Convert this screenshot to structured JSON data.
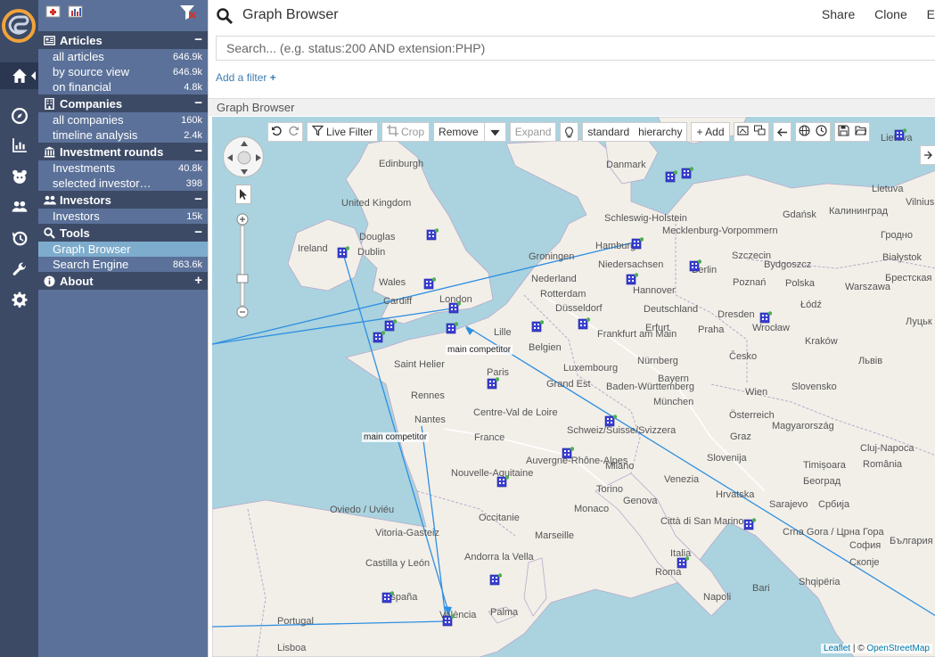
{
  "sidebar": {
    "sections": [
      {
        "title": "Articles",
        "toggle": "−",
        "items": [
          {
            "label": "all articles",
            "count": "646.9k"
          },
          {
            "label": "by source view",
            "count": "646.9k"
          },
          {
            "label": "on financial",
            "count": "4.8k"
          }
        ]
      },
      {
        "title": "Companies",
        "toggle": "−",
        "items": [
          {
            "label": "all companies",
            "count": "160k"
          },
          {
            "label": "timeline analysis",
            "count": "2.4k"
          }
        ]
      },
      {
        "title": "Investment rounds",
        "toggle": "−",
        "items": [
          {
            "label": "Investments",
            "count": "40.8k"
          },
          {
            "label": "selected investor…",
            "count": "398"
          }
        ]
      },
      {
        "title": "Investors",
        "toggle": "−",
        "items": [
          {
            "label": "Investors",
            "count": "15k"
          }
        ]
      },
      {
        "title": "Tools",
        "toggle": "−",
        "items": [
          {
            "label": "Graph Browser",
            "count": ""
          },
          {
            "label": "Search Engine",
            "count": "863.6k"
          }
        ]
      },
      {
        "title": "About",
        "toggle": "+",
        "items": []
      }
    ]
  },
  "header": {
    "title": "Graph Browser",
    "share": "Share",
    "clone": "Clone",
    "extra": "E"
  },
  "search": {
    "placeholder": "Search... (e.g. status:200 AND extension:PHP)"
  },
  "add_filter": "Add a filter",
  "panel_title": "Graph Browser",
  "toolbar": {
    "live_filter": "Live Filter",
    "crop": "Crop",
    "remove": "Remove",
    "expand": "Expand",
    "layout_standard": "standard",
    "layout_hierarchy": "hierarchy",
    "add": "+ Add"
  },
  "map": {
    "places": [
      {
        "text": "Edinburgh"
      },
      {
        "text": "Danmark"
      },
      {
        "text": "United Kingdom"
      },
      {
        "text": "Ireland"
      },
      {
        "text": "Douglas"
      },
      {
        "text": "Dublin"
      },
      {
        "text": "Wales"
      },
      {
        "text": "Cardiff"
      },
      {
        "text": "London"
      },
      {
        "text": "Hamburg"
      },
      {
        "text": "Groningen"
      },
      {
        "text": "Nederland"
      },
      {
        "text": "Rotterdam"
      },
      {
        "text": "Hannover"
      },
      {
        "text": "Berlin"
      },
      {
        "text": "Szczecin"
      },
      {
        "text": "Gdańsk"
      },
      {
        "text": "Калининград"
      },
      {
        "text": "Lietuva"
      },
      {
        "text": "Vilnius"
      },
      {
        "text": "Гродно"
      },
      {
        "text": "Białystok"
      },
      {
        "text": "Bydgoszcz"
      },
      {
        "text": "Poznań"
      },
      {
        "text": "Polska"
      },
      {
        "text": "Warszawa"
      },
      {
        "text": "Łódź"
      },
      {
        "text": "Deutschland"
      },
      {
        "text": "Düsseldorf"
      },
      {
        "text": "Dresden"
      },
      {
        "text": "Wrocław"
      },
      {
        "text": "Lille"
      },
      {
        "text": "Belgien"
      },
      {
        "text": "Frankfurt am Main"
      },
      {
        "text": "Erfurt"
      },
      {
        "text": "Praha"
      },
      {
        "text": "Česko"
      },
      {
        "text": "Kraków"
      },
      {
        "text": "Luxembourg"
      },
      {
        "text": "Nürnberg"
      },
      {
        "text": "Saint Helier"
      },
      {
        "text": "Paris"
      },
      {
        "text": "Rennes"
      },
      {
        "text": "Nantes"
      },
      {
        "text": "Centre-Val de Loire"
      },
      {
        "text": "France"
      },
      {
        "text": "München"
      },
      {
        "text": "Wien"
      },
      {
        "text": "Österreich"
      },
      {
        "text": "Slovensko"
      },
      {
        "text": "Magyarország"
      },
      {
        "text": "Schweiz/Suisse/Svizzera"
      },
      {
        "text": "Graz"
      },
      {
        "text": "Cluj-Napoca"
      },
      {
        "text": "România"
      },
      {
        "text": "Nouvelle-Aquitaine"
      },
      {
        "text": "Auvergne-Rhône-Alpes"
      },
      {
        "text": "Milano"
      },
      {
        "text": "Venezia"
      },
      {
        "text": "Slovenija"
      },
      {
        "text": "Hrvatska"
      },
      {
        "text": "Timișoara"
      },
      {
        "text": "Београд"
      },
      {
        "text": "Torino"
      },
      {
        "text": "Genova"
      },
      {
        "text": "Sarajevo"
      },
      {
        "text": "Србија"
      },
      {
        "text": "Occitanie"
      },
      {
        "text": "Monaco"
      },
      {
        "text": "Marseille"
      },
      {
        "text": "Città di San Marino"
      },
      {
        "text": "Italia"
      },
      {
        "text": "Crna Gora / Црна Гора"
      },
      {
        "text": "София"
      },
      {
        "text": "Скопје"
      },
      {
        "text": "Shqipëria"
      },
      {
        "text": "Oviedo / Uviéu"
      },
      {
        "text": "Vitoria-Gasteiz"
      },
      {
        "text": "Castilla y León"
      },
      {
        "text": "Andorra la Vella"
      },
      {
        "text": "Roma"
      },
      {
        "text": "Bari"
      },
      {
        "text": "Napoli"
      },
      {
        "text": "España"
      },
      {
        "text": "Palma"
      },
      {
        "text": "València"
      },
      {
        "text": "Portugal"
      },
      {
        "text": "Lisboa"
      },
      {
        "text": "Lietuva"
      },
      {
        "text": "Брестская область"
      },
      {
        "text": "Луцьк"
      },
      {
        "text": "Львів"
      },
      {
        "text": "България"
      },
      {
        "text": "Schleswig-Holstein"
      },
      {
        "text": "Mecklenburg-Vorpommern"
      },
      {
        "text": "Niedersachsen"
      },
      {
        "text": "Baden-Württemberg"
      },
      {
        "text": "Bayern"
      },
      {
        "text": "Grand Est"
      }
    ],
    "edge_labels": [
      "main competitor",
      "main competitor"
    ],
    "attribution_leaflet": "Leaflet",
    "attribution_sep": "| ©",
    "attribution_osm": "OpenStreetMap"
  }
}
